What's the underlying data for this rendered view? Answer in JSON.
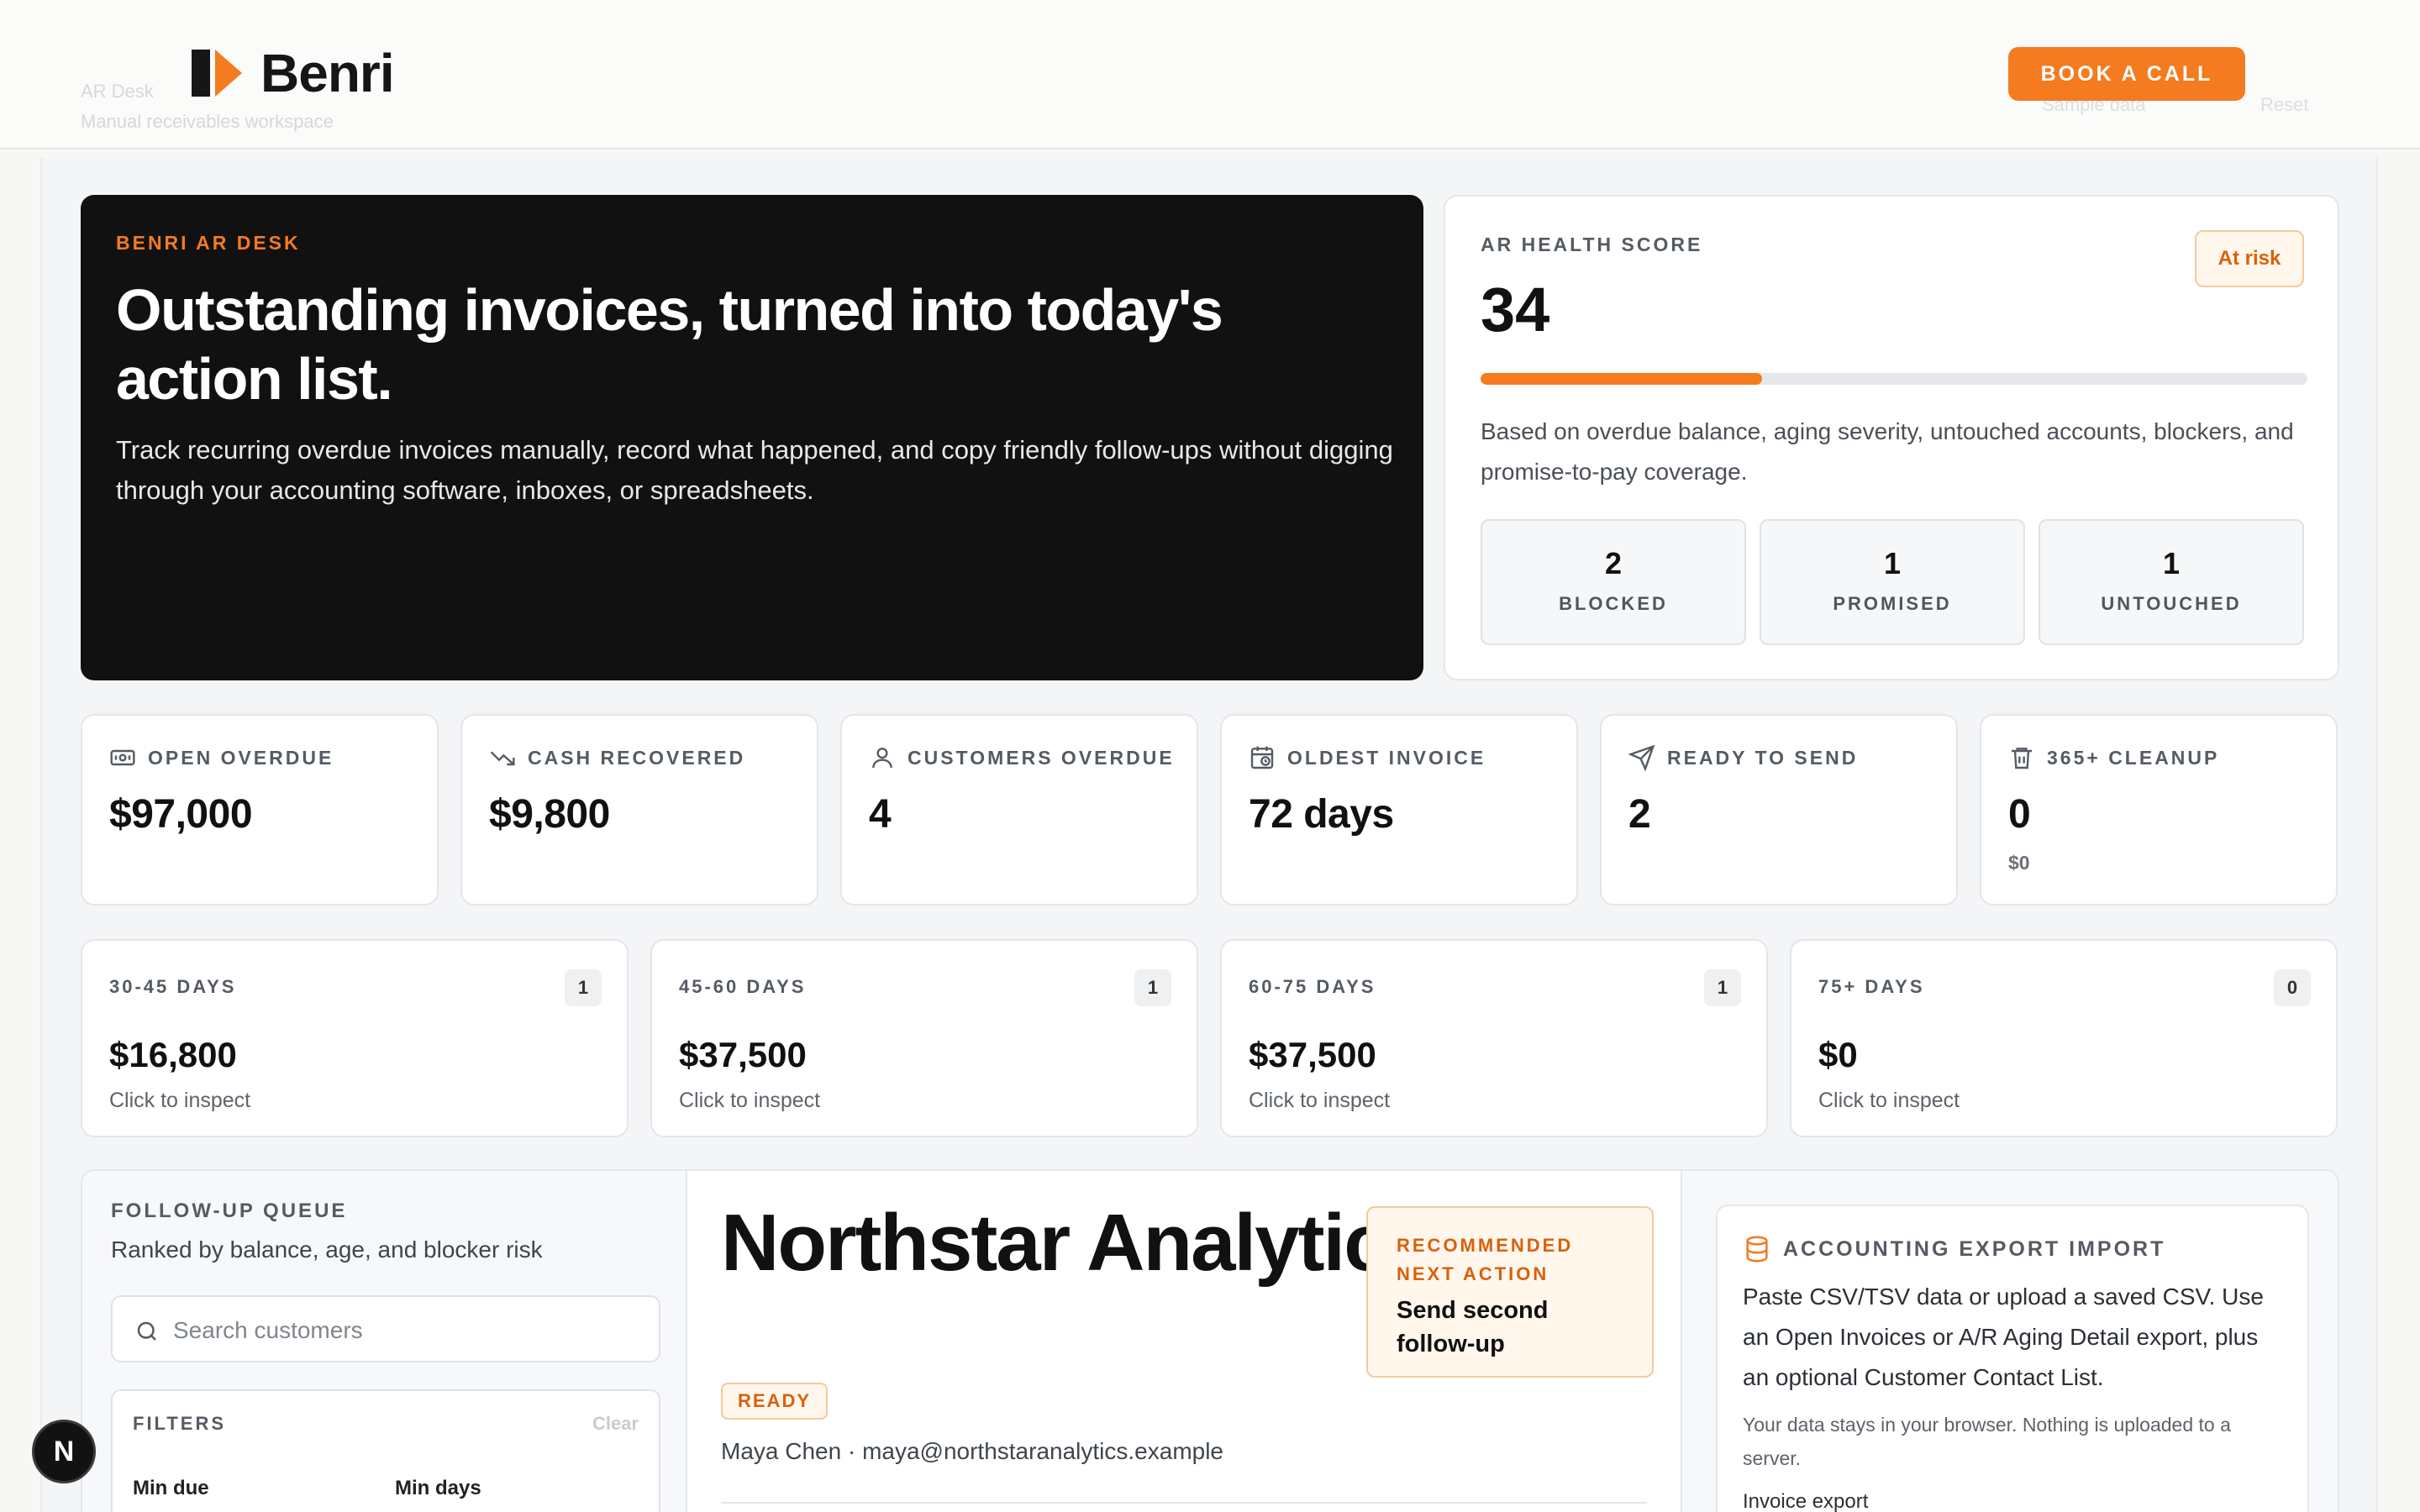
{
  "brand": {
    "name": "Benri",
    "accent": "#f47b20",
    "dark": "#111111"
  },
  "ghost": {
    "title": "AR Desk",
    "subtitle": "Manual receivables workspace",
    "action_sample": "Sample data",
    "action_reset": "Reset"
  },
  "header": {
    "book_call": "BOOK A CALL"
  },
  "hero": {
    "eyebrow": "BENRI AR DESK",
    "title": "Outstanding invoices, turned into today's action list.",
    "description": "Track recurring overdue invoices manually, record what happened, and copy friendly follow-ups without digging through your accounting software, inboxes, or spreadsheets."
  },
  "health": {
    "label": "AR HEALTH SCORE",
    "score": "34",
    "score_fraction": 0.34,
    "badge": "At risk",
    "description": "Based on overdue balance, aging severity, untouched accounts, blockers, and promise-to-pay coverage.",
    "tiles": [
      {
        "value": "2",
        "label": "BLOCKED"
      },
      {
        "value": "1",
        "label": "PROMISED"
      },
      {
        "value": "1",
        "label": "UNTOUCHED"
      }
    ]
  },
  "stats": [
    {
      "icon": "cash-icon",
      "label": "OPEN OVERDUE",
      "value": "$97,000",
      "sub": ""
    },
    {
      "icon": "trend-down-icon",
      "label": "CASH RECOVERED",
      "value": "$9,800",
      "sub": ""
    },
    {
      "icon": "user-icon",
      "label": "CUSTOMERS OVERDUE",
      "value": "4",
      "sub": ""
    },
    {
      "icon": "calendar-clock-icon",
      "label": "OLDEST INVOICE",
      "value": "72 days",
      "sub": ""
    },
    {
      "icon": "send-icon",
      "label": "READY TO SEND",
      "value": "2",
      "sub": ""
    },
    {
      "icon": "trash-icon",
      "label": "365+ CLEANUP",
      "value": "0",
      "sub": "$0"
    }
  ],
  "aging": [
    {
      "label": "30-45 DAYS",
      "count": "1",
      "value": "$16,800",
      "sub": "Click to inspect"
    },
    {
      "label": "45-60 DAYS",
      "count": "1",
      "value": "$37,500",
      "sub": "Click to inspect"
    },
    {
      "label": "60-75 DAYS",
      "count": "1",
      "value": "$37,500",
      "sub": "Click to inspect"
    },
    {
      "label": "75+ DAYS",
      "count": "0",
      "value": "$0",
      "sub": "Click to inspect"
    }
  ],
  "queue": {
    "label": "FOLLOW-UP QUEUE",
    "subtitle": "Ranked by balance, age, and blocker risk",
    "search_placeholder": "Search customers",
    "filters": {
      "label": "FILTERS",
      "clear": "Clear",
      "min_due": "Min due",
      "min_days": "Min days"
    }
  },
  "detail": {
    "name": "Northstar Analytics",
    "status": "READY",
    "contact": "Maya Chen · maya@northstaranalytics.example",
    "recommended_label": "RECOMMENDED NEXT ACTION",
    "recommended_value": "Send second follow-up"
  },
  "import": {
    "label": "ACCOUNTING EXPORT IMPORT",
    "description": "Paste CSV/TSV data or upload a saved CSV. Use an Open Invoices or A/R Aging Detail export, plus an optional Customer Contact List.",
    "note": "Your data stays in your browser. Nothing is uploaded to a server.",
    "more": "Invoice export"
  },
  "dev_badge": "N"
}
